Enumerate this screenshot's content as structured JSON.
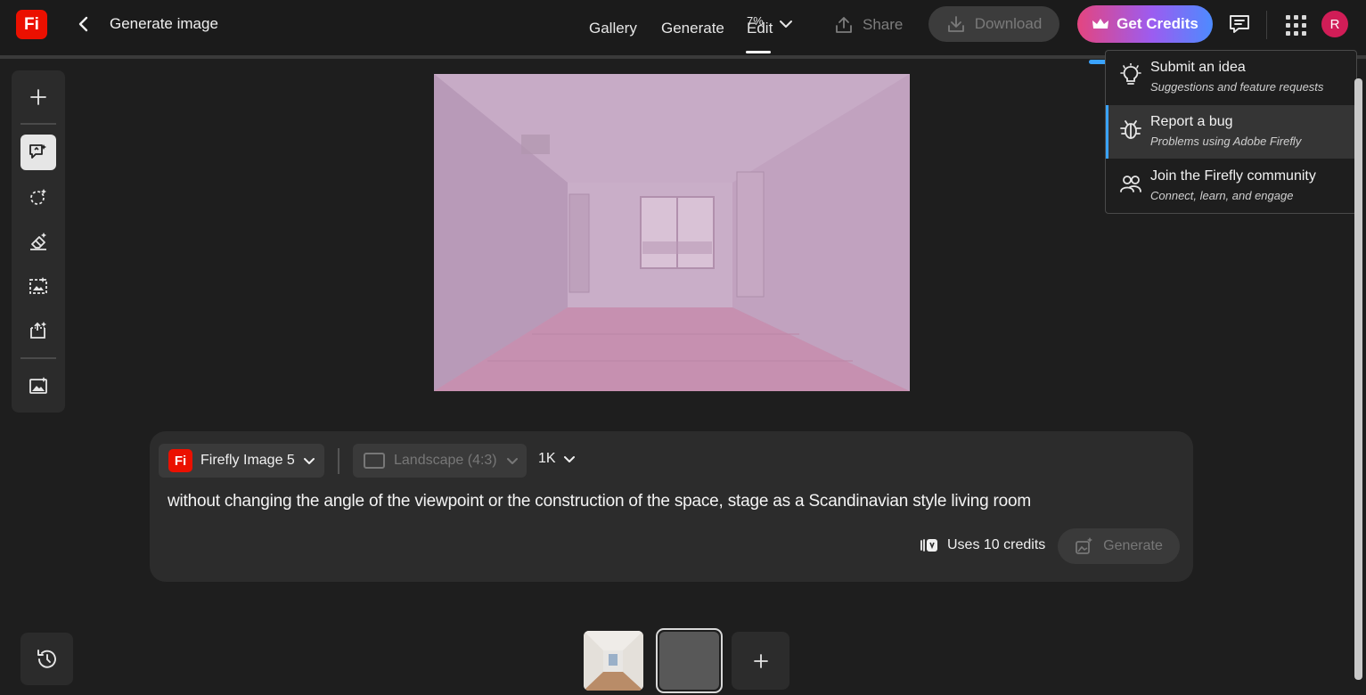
{
  "app": {
    "logo_text": "Fi",
    "title": "Generate image"
  },
  "nav": {
    "gallery": "Gallery",
    "generate": "Generate",
    "edit": "Edit",
    "zoom": "7%"
  },
  "header": {
    "share_label": "Share",
    "download_label": "Download",
    "get_credits_label": "Get Credits",
    "avatar_initial": "R"
  },
  "feedback_menu": {
    "items": [
      {
        "title": "Submit an idea",
        "subtitle": "Suggestions and feature requests"
      },
      {
        "title": "Report a bug",
        "subtitle": "Problems using Adobe Firefly"
      },
      {
        "title": "Join the Firefly community",
        "subtitle": "Connect, learn, and engage"
      }
    ]
  },
  "prompt_panel": {
    "model_logo": "Fi",
    "model": "Firefly Image 5",
    "aspect_ratio": "Landscape (4:3)",
    "resolution": "1K",
    "prompt": "without changing the angle of the viewpoint or the construction of the space, stage as a Scandinavian style living room",
    "credits": "Uses 10 credits",
    "generate_label": "Generate"
  },
  "colors": {
    "brand": "#eb1000",
    "accent": "#3aa3ff",
    "background": "#1e1e1e",
    "avatar": "#d11d57"
  },
  "icons": {
    "toolbar": [
      "plus-icon",
      "prompt-edit-icon",
      "select-icon",
      "erase-icon",
      "expand-image-icon",
      "crop-icon",
      "image-icon"
    ],
    "history": "history-icon"
  }
}
